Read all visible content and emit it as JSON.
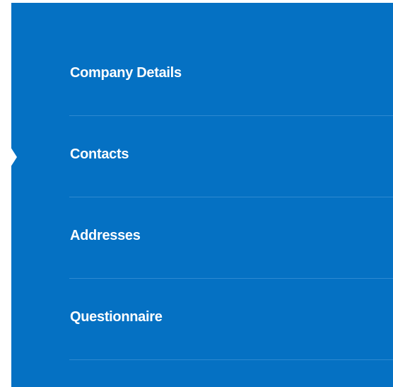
{
  "colors": {
    "panel_bg": "#0571c3",
    "divider": "#2e8ad1",
    "text": "#ffffff",
    "active_indicator": "#ffffff"
  },
  "nav": {
    "active_index": 1,
    "items": [
      {
        "label": "Company Details"
      },
      {
        "label": "Contacts"
      },
      {
        "label": "Addresses"
      },
      {
        "label": "Questionnaire"
      }
    ]
  }
}
